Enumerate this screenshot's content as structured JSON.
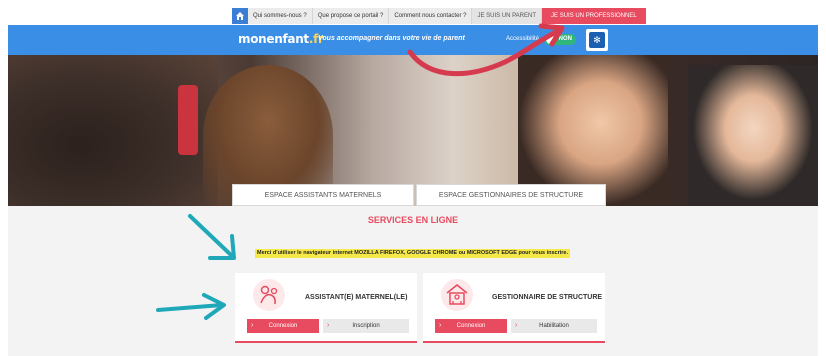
{
  "topnav": {
    "home_icon": "home-icon",
    "items": [
      {
        "label": "Qui sommes-nous ?"
      },
      {
        "label": "Que propose ce portail ?"
      },
      {
        "label": "Comment nous contacter ?"
      },
      {
        "label": "JE SUIS UN PARENT"
      },
      {
        "label": "JE SUIS UN PROFESSIONNEL"
      }
    ]
  },
  "header": {
    "logo_main": "monenfant",
    "logo_dot": ".fr",
    "tagline": "Vous accompagner dans votre vie de parent",
    "accessibility_label": "Accessibilité",
    "toggle_state": "NON",
    "partner_logo": "caf-logo"
  },
  "tabs": [
    {
      "label": "ESPACE ASSISTANTS MATERNELS"
    },
    {
      "label": "ESPACE GESTIONNAIRES DE STRUCTURE"
    }
  ],
  "main": {
    "services_title": "SERVICES EN LIGNE",
    "browser_notice": "Merci d'utiliser le navigateur internet MOZILLA FIREFOX, GOOGLE CHROME ou MICROSOFT EDGE pour vous inscrire."
  },
  "cards": [
    {
      "title": "ASSISTANT(E) MATERNEL(LE)",
      "icon": "nanny-icon",
      "primary": "Connexion",
      "secondary": "Inscription"
    },
    {
      "title": "GESTIONNAIRE DE STRUCTURE",
      "icon": "building-icon",
      "primary": "Connexion",
      "secondary": "Habilitation"
    }
  ],
  "colors": {
    "accent": "#e84a5f",
    "header_blue": "#3a8ee6",
    "annotation_teal": "#1fa8b8",
    "annotation_red": "#d63a4f"
  }
}
